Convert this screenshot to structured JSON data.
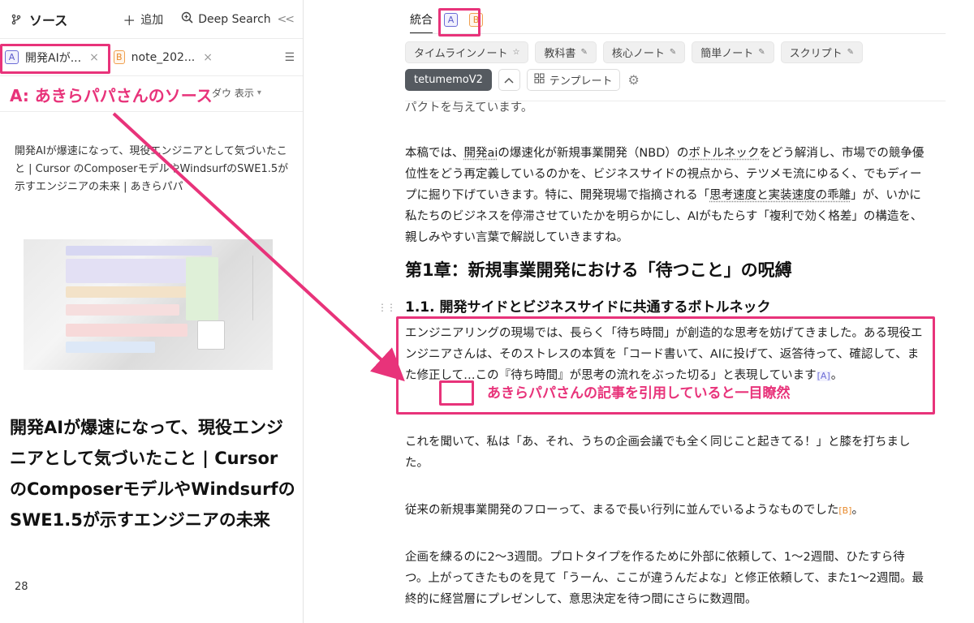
{
  "left": {
    "title": "ソース",
    "add_label": "追加",
    "deep_search_label": "Deep Search",
    "collapse_label": "<<",
    "tabs": [
      {
        "badge": "A",
        "label": "開発AIが...",
        "close": "×"
      },
      {
        "badge": "B",
        "label": "note_202...",
        "close": "×"
      }
    ],
    "tabs_menu": "☰",
    "view_select": "ダウ 表示",
    "source_desc": "開発AIが爆速になって、現役エンジニアとして気づいたこと | Cursor のComposerモデルやWindsurfのSWE1.5が示すエンジニアの未来 | あきらパパ",
    "source_title": "開発AIが爆速になって、現役エンジニアとして気づいたこと | Cursor のComposerモデルやWindsurfのSWE1.5が示すエンジニアの未来",
    "count": "28"
  },
  "right": {
    "view_tab_integrated": "統合",
    "view_tab_a": "A",
    "view_tab_b": "B",
    "chips_row1": [
      {
        "label": "タイムラインノート",
        "icon": "☆"
      },
      {
        "label": "教科書",
        "icon": "✎"
      },
      {
        "label": "核心ノート",
        "icon": "✎"
      },
      {
        "label": "簡単ノート",
        "icon": "✎"
      },
      {
        "label": "スクリプト",
        "icon": "✎"
      }
    ],
    "chip_active": "tetumemoV2",
    "template_label": "テンプレート",
    "cut_line": "パクトを与えています。",
    "p1_a": "本稿では、",
    "p1_ul1": "開発ai",
    "p1_b": "の爆速化が新規事業開発（NBD）の",
    "p1_ul2": "ボトルネック",
    "p1_c": "をどう解消し、市場での競争優位性をどう再定義しているのかを、ビジネスサイドの視点から、テツメモ流にゆるく、でもディープに掘り下げていきます。特に、開発現場で指摘される「",
    "p1_ul3": "思考速度と実装速度の乖離",
    "p1_d": "」が、いかに私たちのビジネスを停滞させていたかを明らかにし、AIがもたらす「複利で効く格差」の構造を、親しみやすい言葉で解説していきますね。",
    "h2": "第1章：新規事業開発における「待つこと」の呪縛",
    "h3": "1.1. 開発サイドとビジネスサイドに共通するボトルネック",
    "p2": "エンジニアリングの現場では、長らく「待ち時間」が創造的な思考を妨げてきました。ある現役エンジニアさんは、そのストレスの本質を「コード書いて、AIに投げて、返答待って、確認して、また修正して…この『待ち時間』が思考の流れをぶった切る」と表現しています",
    "p2_ref": "[A]",
    "p2_end": "。",
    "p3": "これを聞いて、私は「あ、それ、うちの企画会議でも全く同じこと起きてる！」と膝を打ちました。",
    "p4": "従来の新規事業開発のフローって、まるで長い行列に並んでいるようなものでした",
    "p4_ref": "[B]",
    "p4_end": "。",
    "p5": "企画を練るのに2〜3週間。プロトタイプを作るために外部に依頼して、1〜2週間、ひたすら待つ。上がってきたものを見て「うーん、ここが違うんだよな」と修正依頼して、また1〜2週間。最終的に経営層にプレゼンして、意思決定を待つ間にさらに数週間。"
  },
  "annotations": {
    "left_label": "A: あきらパパさんのソース",
    "right_label": "あきらパパさんの記事を引用していると一目瞭然",
    "color": "#e8337a"
  }
}
